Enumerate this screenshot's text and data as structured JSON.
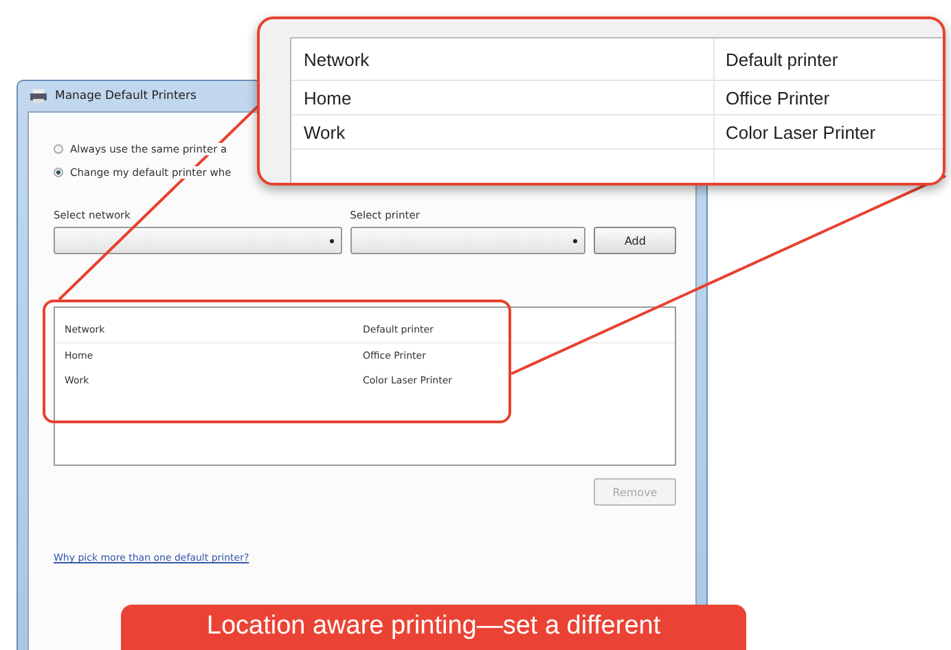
{
  "window": {
    "title": "Manage Default Printers"
  },
  "options": [
    {
      "label": "Always use the same printer a",
      "selected": false
    },
    {
      "label": "Change my default printer whe",
      "selected": true
    }
  ],
  "network_select": {
    "label": "Select network"
  },
  "printer_select": {
    "label": "Select printer"
  },
  "add_button": "Add",
  "table": {
    "columns": [
      "Network",
      "Default printer"
    ],
    "rows": [
      [
        "Home",
        "Office Printer"
      ],
      [
        "Work",
        "Color Laser Printer"
      ]
    ]
  },
  "remove_button": {
    "label": "Remove",
    "disabled": true
  },
  "help_link": "Why pick more than one default printer?",
  "zoom_callout": {
    "columns": [
      "Network",
      "Default printer"
    ],
    "rows": [
      [
        "Home",
        "Office Printer"
      ],
      [
        "Work",
        "Color Laser Printer"
      ]
    ]
  },
  "caption": "Location aware printing—set a different"
}
